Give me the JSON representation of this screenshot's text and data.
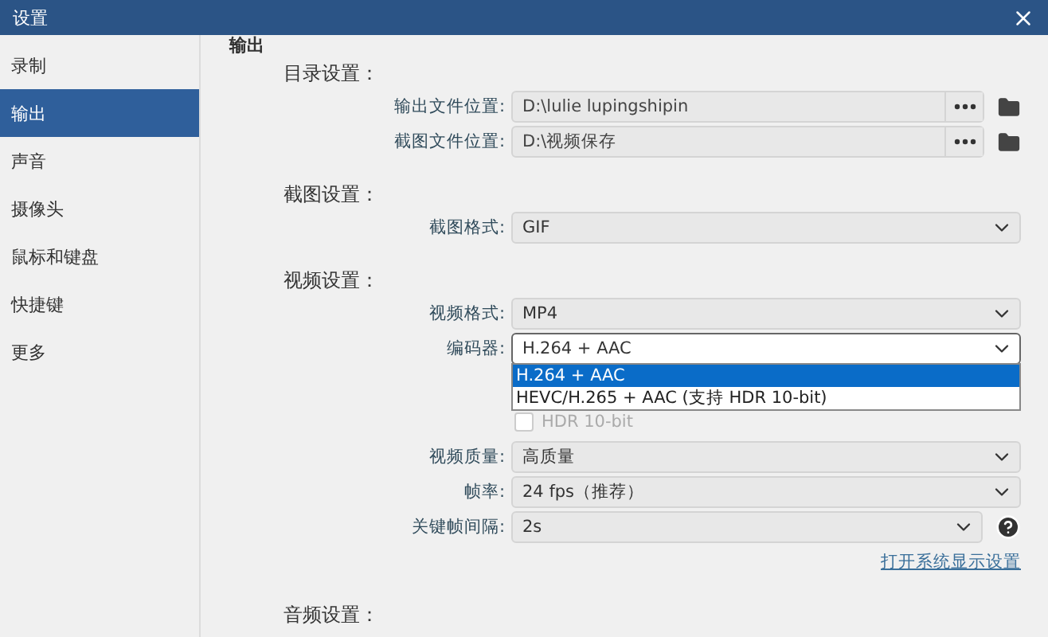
{
  "window": {
    "title": "设置"
  },
  "sidebar": {
    "items": [
      {
        "label": "录制",
        "selected": false
      },
      {
        "label": "输出",
        "selected": true
      },
      {
        "label": "声音",
        "selected": false
      },
      {
        "label": "摄像头",
        "selected": false
      },
      {
        "label": "鼠标和键盘",
        "selected": false
      },
      {
        "label": "快捷键",
        "selected": false
      },
      {
        "label": "更多",
        "selected": false
      }
    ]
  },
  "page": {
    "heading": "输出",
    "sections": [
      {
        "title": "目录设置：",
        "rows": [
          {
            "kind": "path",
            "label": "输出文件位置:",
            "value": "D:\\lulie lupingshipin"
          },
          {
            "kind": "path",
            "label": "截图文件位置:",
            "value": "D:\\视频保存"
          }
        ]
      },
      {
        "title": "截图设置：",
        "rows": [
          {
            "kind": "select",
            "label": "截图格式:",
            "value": "GIF",
            "expanded": false
          }
        ]
      },
      {
        "title": "视频设置：",
        "rows": [
          {
            "kind": "select",
            "label": "视频格式:",
            "value": "MP4",
            "expanded": false
          },
          {
            "kind": "select",
            "label": "编码器:",
            "value": "H.264 + AAC",
            "expanded": true,
            "options": [
              {
                "label": "H.264 + AAC",
                "selected": true
              },
              {
                "label": "HEVC/H.265 + AAC (支持 HDR 10-bit)",
                "selected": false
              }
            ]
          },
          {
            "kind": "checkbox",
            "label": "HDR 10-bit",
            "checked": false,
            "disabled": true
          },
          {
            "kind": "select",
            "label": "视频质量:",
            "value": "高质量",
            "expanded": false
          },
          {
            "kind": "select",
            "label": "帧率:",
            "value": "24 fps（推荐）",
            "expanded": false
          },
          {
            "kind": "select",
            "label": "关键帧间隔:",
            "value": "2s",
            "expanded": false,
            "help": true
          },
          {
            "kind": "link",
            "text": "打开系统显示设置"
          }
        ]
      },
      {
        "title": "音频设置："
      }
    ]
  }
}
